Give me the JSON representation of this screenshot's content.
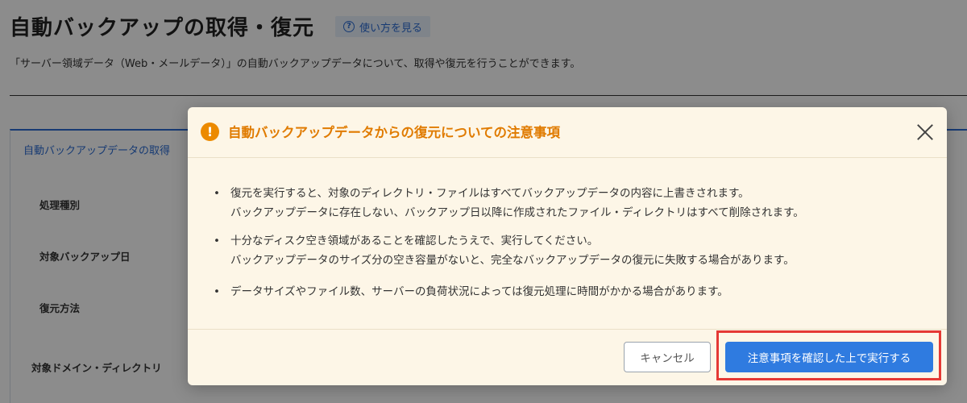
{
  "page": {
    "title": "自動バックアップの取得・復元",
    "help_link": "使い方を見る",
    "description": "「サーバー領域データ（Web・メールデータ）」の自動バックアップデータについて、取得や復元を行うことができます。",
    "panel_tab": "自動バックアップデータの取得",
    "form_labels": [
      "処理種別",
      "対象バックアップ日",
      "復元方法",
      "対象ドメイン・ディレクトリ"
    ]
  },
  "modal": {
    "icon": "exclamation-warning-icon",
    "title": "自動バックアップデータからの復元についての注意事項",
    "notes": [
      {
        "line1": "復元を実行すると、対象のディレクトリ・ファイルはすべてバックアップデータの内容に上書きされます。",
        "line2": "バックアップデータに存在しない、バックアップ日以降に作成されたファイル・ディレクトリはすべて削除されます。"
      },
      {
        "line1": "十分なディスク空き領域があることを確認したうえで、実行してください。",
        "line2": "バックアップデータのサイズ分の空き容量がないと、完全なバックアップデータの復元に失敗する場合があります。"
      },
      {
        "line1": "データサイズやファイル数、サーバーの負荷状況によっては復元処理に時間がかかる場合があります。"
      }
    ],
    "cancel_label": "キャンセル",
    "confirm_label": "注意事項を確認した上で実行する"
  },
  "colors": {
    "accent": "#2f7be0",
    "warning": "#ec8a00",
    "highlight": "#e53935",
    "modal_bg": "#fdf6e7"
  }
}
